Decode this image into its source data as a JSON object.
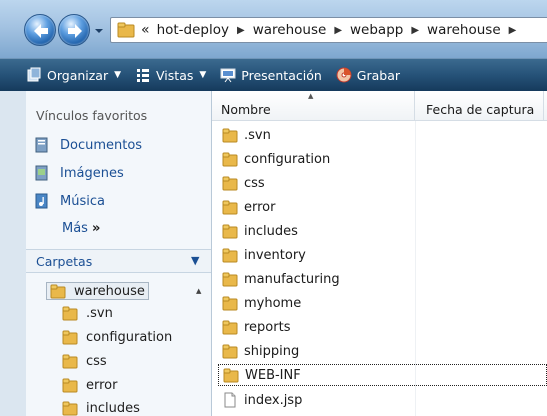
{
  "address_bar": {
    "overflow_chevron": "«",
    "breadcrumbs": [
      "hot-deploy",
      "warehouse",
      "webapp",
      "warehouse"
    ]
  },
  "toolbar": {
    "items": [
      {
        "label": "Organizar",
        "icon": "organize-icon",
        "dropdown": true
      },
      {
        "label": "Vistas",
        "icon": "views-icon",
        "dropdown": true
      },
      {
        "label": "Presentación",
        "icon": "presentation-icon",
        "dropdown": false
      },
      {
        "label": "Grabar",
        "icon": "burn-icon",
        "dropdown": false
      }
    ]
  },
  "navigation": {
    "favorites_header": "Vínculos favoritos",
    "favorites": [
      {
        "label": "Documentos",
        "icon": "documents-icon"
      },
      {
        "label": "Imágenes",
        "icon": "pictures-icon"
      },
      {
        "label": "Música",
        "icon": "music-icon"
      }
    ],
    "more_label": "Más",
    "more_arrows": "»",
    "folders_header": "Carpetas",
    "tree_selected": "warehouse",
    "tree_children": [
      ".svn",
      "configuration",
      "css",
      "error",
      "includes"
    ]
  },
  "file_list": {
    "columns": {
      "name": "Nombre",
      "date": "Fecha de captura"
    },
    "items": [
      {
        "name": ".svn",
        "type": "folder"
      },
      {
        "name": "configuration",
        "type": "folder"
      },
      {
        "name": "css",
        "type": "folder"
      },
      {
        "name": "error",
        "type": "folder"
      },
      {
        "name": "includes",
        "type": "folder"
      },
      {
        "name": "inventory",
        "type": "folder"
      },
      {
        "name": "manufacturing",
        "type": "folder"
      },
      {
        "name": "myhome",
        "type": "folder"
      },
      {
        "name": "reports",
        "type": "folder"
      },
      {
        "name": "shipping",
        "type": "folder"
      },
      {
        "name": "WEB-INF",
        "type": "folder",
        "focused": true
      },
      {
        "name": "index.jsp",
        "type": "file"
      }
    ]
  },
  "colors": {
    "folder_yellow": "#e9b84a",
    "link_blue": "#1b4f94",
    "toolbar_dark": "#265278"
  }
}
